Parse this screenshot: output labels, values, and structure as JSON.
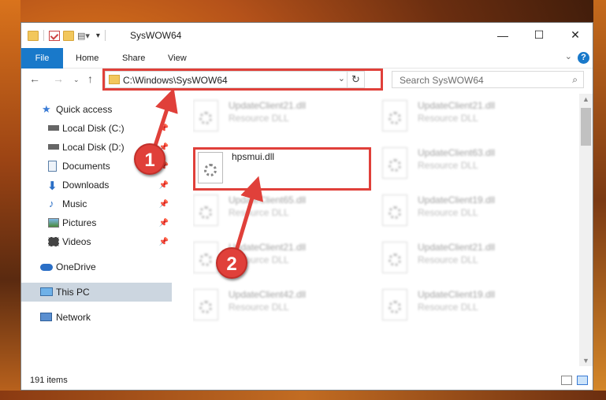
{
  "window": {
    "title": "SysWOW64",
    "minimize": "—",
    "maximize": "☐",
    "close": "✕"
  },
  "ribbon": {
    "tabs": [
      "File",
      "Home",
      "Share",
      "View"
    ],
    "help": "?"
  },
  "navigation": {
    "address": "C:\\Windows\\SysWOW64",
    "search_placeholder": "Search SysWOW64"
  },
  "sidebar": {
    "items": [
      {
        "label": "Quick access",
        "icon": "star-icon"
      },
      {
        "label": "Local Disk (C:)",
        "icon": "drive-icon",
        "pinned": true
      },
      {
        "label": "Local Disk (D:)",
        "icon": "drive-icon",
        "pinned": true
      },
      {
        "label": "Documents",
        "icon": "documents-icon",
        "pinned": true
      },
      {
        "label": "Downloads",
        "icon": "downloads-icon",
        "pinned": true
      },
      {
        "label": "Music",
        "icon": "music-icon",
        "pinned": true
      },
      {
        "label": "Pictures",
        "icon": "pictures-icon",
        "pinned": true
      },
      {
        "label": "Videos",
        "icon": "videos-icon",
        "pinned": true
      },
      {
        "label": "OneDrive",
        "icon": "onedrive-icon"
      },
      {
        "label": "This PC",
        "icon": "computer-icon",
        "selected": true
      },
      {
        "label": "Network",
        "icon": "network-icon"
      }
    ]
  },
  "files": [
    {
      "name": "UpdateClient21.dll",
      "type": "Resource DLL"
    },
    {
      "name": "UpdateClient21.dll",
      "type": "Resource DLL"
    },
    {
      "name": "UpdateClient63.dll",
      "type": "Resource DLL"
    },
    {
      "name": "UpdateClient65.dll",
      "type": "Resource DLL"
    },
    {
      "name": "UpdateClient19.dll",
      "type": "Resource DLL"
    },
    {
      "name": "UpdateClient21.dll",
      "type": "Resource DLL"
    },
    {
      "name": "UpdateClient21.dll",
      "type": "Resource DLL"
    },
    {
      "name": "UpdateClient42.dll",
      "type": "Resource DLL"
    },
    {
      "name": "UpdateClient19.dll",
      "type": "Resource DLL"
    }
  ],
  "highlighted_file": {
    "name": "hpsmui.dll"
  },
  "status": {
    "item_count": "191 items"
  },
  "annotations": [
    "1",
    "2"
  ],
  "colors": {
    "accent": "#1979ca",
    "highlight": "#e0403a"
  }
}
